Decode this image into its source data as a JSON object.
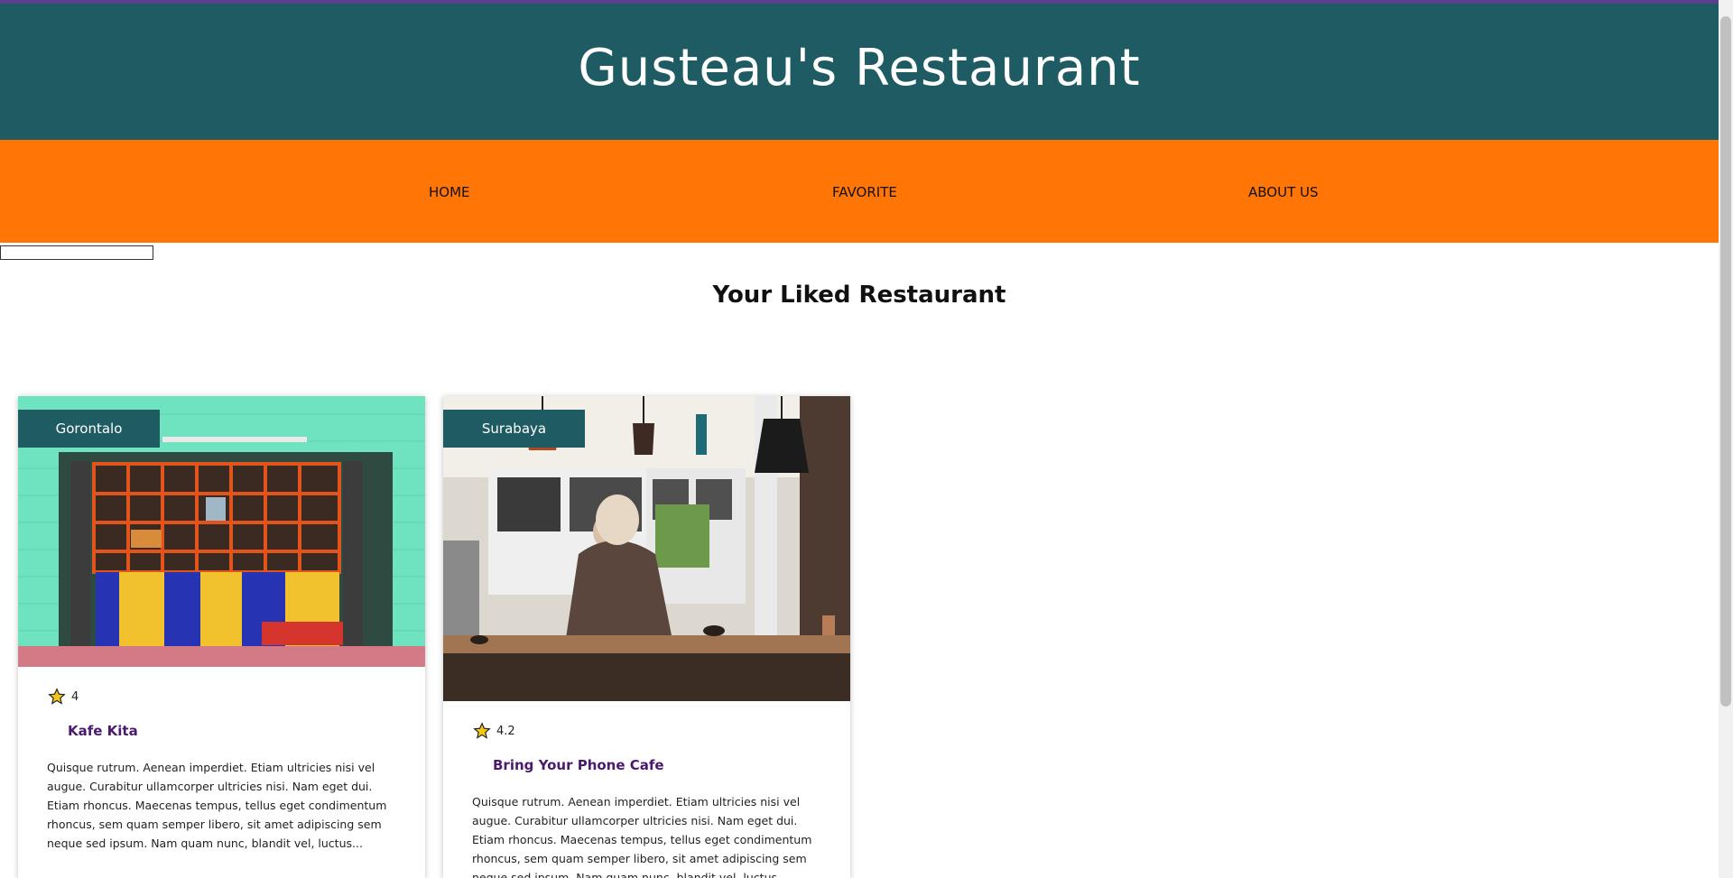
{
  "header": {
    "title": "Gusteau's Restaurant"
  },
  "nav": {
    "items": [
      {
        "label": "HOME"
      },
      {
        "label": "FAVORITE"
      },
      {
        "label": "ABOUT US"
      }
    ]
  },
  "main": {
    "title": "Your Liked Restaurant",
    "restaurants": [
      {
        "city": "Gorontalo",
        "rating": "4",
        "name": "Kafe Kita",
        "description": "Quisque rutrum. Aenean imperdiet. Etiam ultricies nisi vel augue. Curabitur ullamcorper ultricies nisi. Nam eget dui. Etiam rhoncus. Maecenas tempus, tellus eget condimentum rhoncus, sem quam semper libero, sit amet adipiscing sem neque sed ipsum. Nam quam nunc, blandit vel, luctus..."
      },
      {
        "city": "Surabaya",
        "rating": "4.2",
        "name": "Bring Your Phone Cafe",
        "description": "Quisque rutrum. Aenean imperdiet. Etiam ultricies nisi vel augue. Curabitur ullamcorper ultricies nisi. Nam eget dui. Etiam rhoncus. Maecenas tempus, tellus eget condimentum rhoncus, sem quam semper libero, sit amet adipiscing sem neque sed ipsum. Nam quam nunc, blandit vel, luctus..."
      }
    ]
  },
  "colors": {
    "header": "#1e5b63",
    "nav": "#ff7506",
    "accent_name": "#4b1a6e",
    "star": "#f5c518"
  },
  "icons": {
    "rating": "star-icon"
  }
}
